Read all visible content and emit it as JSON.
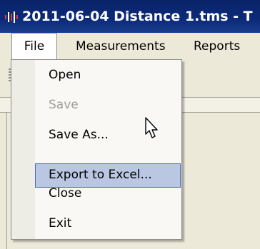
{
  "window": {
    "title": "2011-06-04 Distance 1.tms - T",
    "app_icon": "waveform-icon"
  },
  "menubar": {
    "items": [
      {
        "label": "File"
      },
      {
        "label": "Measurements"
      },
      {
        "label": "Reports"
      }
    ]
  },
  "file_menu": {
    "items": [
      {
        "label": "Open",
        "enabled": true
      },
      {
        "label": "Save",
        "enabled": false
      },
      {
        "label": "Save As...",
        "enabled": true
      },
      {
        "label": "Export to Excel...",
        "enabled": true,
        "highlighted": true
      },
      {
        "label": "Close",
        "enabled": true
      },
      {
        "label": "Exit",
        "enabled": true
      }
    ]
  },
  "colors": {
    "titlebar": "#0a246a",
    "menu_highlight": "#bac7e3",
    "menu_highlight_border": "#4b6ab0",
    "disabled_text": "#9d9d9d"
  }
}
